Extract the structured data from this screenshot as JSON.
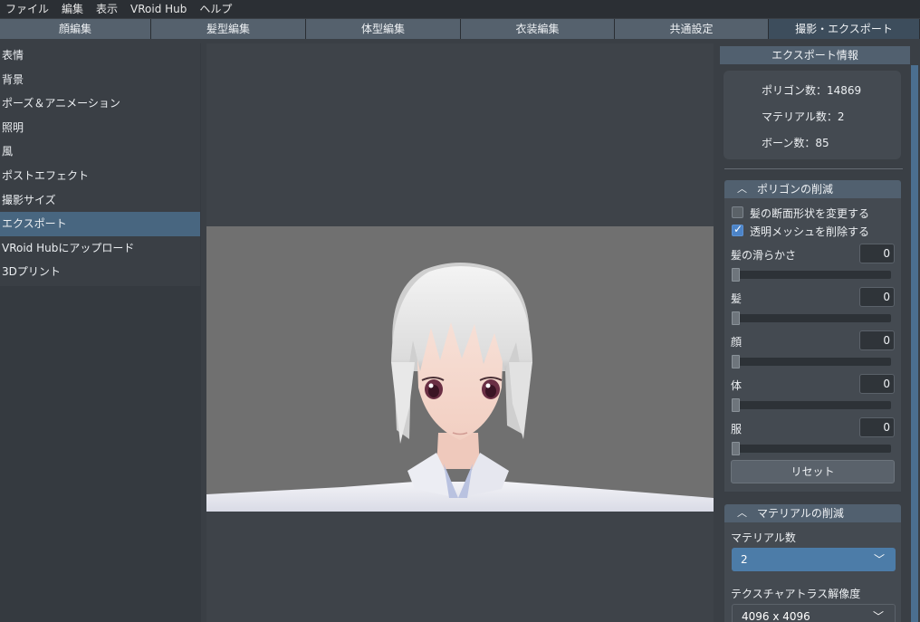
{
  "menu": [
    "ファイル",
    "編集",
    "表示",
    "VRoid Hub",
    "ヘルプ"
  ],
  "tabs": [
    "顔編集",
    "髪型編集",
    "体型編集",
    "衣装編集",
    "共通設定",
    "撮影・エクスポート"
  ],
  "active_tab": "撮影・エクスポート",
  "nav": [
    "表情",
    "背景",
    "ポーズ＆アニメーション",
    "照明",
    "風",
    "ポストエフェクト",
    "撮影サイズ",
    "エクスポート",
    "VRoid Hubにアップロード",
    "3Dプリント"
  ],
  "active_nav": "エクスポート",
  "right": {
    "header": "エクスポート情報",
    "info": [
      "ポリゴン数：14869",
      "マテリアル数：2",
      "ボーン数：85"
    ],
    "poly_section": {
      "title": "ポリゴンの削減",
      "chk_hair_cross": "髪の断面形状を変更する",
      "chk_hair_cross_on": false,
      "chk_transparent": "透明メッシュを削除する",
      "chk_transparent_on": true,
      "sliders": [
        {
          "label": "髪の滑らかさ",
          "value": "0"
        },
        {
          "label": "髪",
          "value": "0"
        },
        {
          "label": "顔",
          "value": "0"
        },
        {
          "label": "体",
          "value": "0"
        },
        {
          "label": "服",
          "value": "0"
        }
      ],
      "reset": "リセット"
    },
    "mat_section": {
      "title": "マテリアルの削減",
      "count_label": "マテリアル数",
      "count_value": "2",
      "atlas_label": "テクスチャアトラス解像度",
      "atlas_value": "4096 x 4096"
    }
  },
  "icons": {
    "collapse": "chevron-up-icon",
    "dropdown": "chevron-down-icon",
    "check": "checkmark-icon"
  },
  "colors": {
    "accent": "#486680",
    "header": "#51606f",
    "checkbox": "#4c84c8",
    "dropdown": "#4c7ca8"
  }
}
